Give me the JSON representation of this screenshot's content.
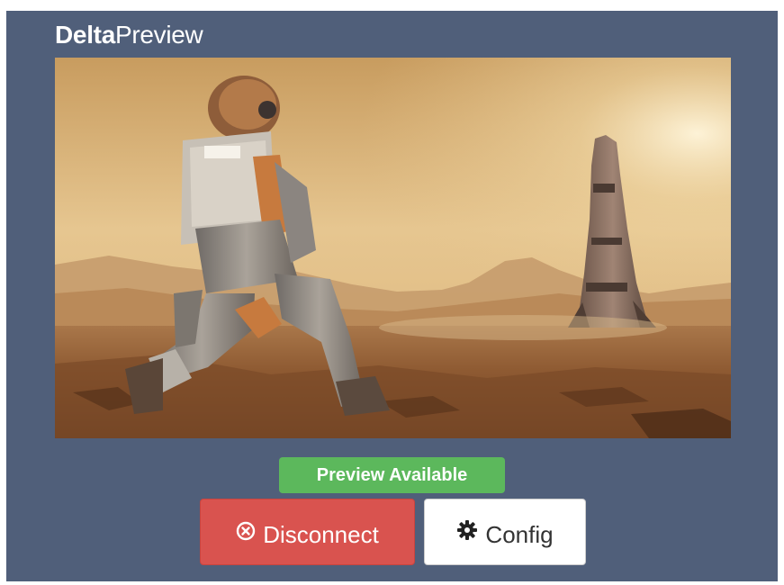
{
  "app": {
    "title_bold": "Delta",
    "title_light": "Preview"
  },
  "preview": {
    "image_alt": "Astronaut kneeling on a desert planet with a rocket in the distance"
  },
  "status": {
    "label": "Preview Available",
    "color": "#5cb85c"
  },
  "actions": {
    "disconnect": {
      "label": "Disconnect",
      "icon": "close-circle-icon",
      "color": "#d9534f"
    },
    "config": {
      "label": "Config",
      "icon": "gear-icon",
      "color": "#ffffff"
    }
  },
  "theme": {
    "panel_background": "#505f7a"
  }
}
